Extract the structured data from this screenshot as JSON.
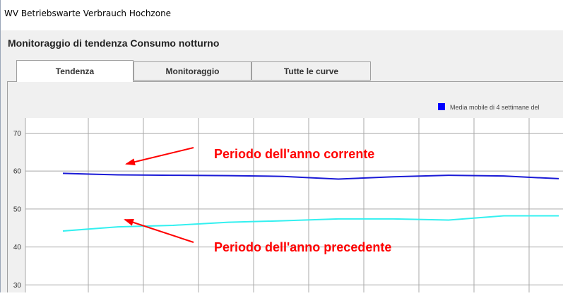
{
  "window": {
    "title": "WV Betriebswarte Verbrauch Hochzone"
  },
  "header": {
    "title": "Monitoraggio di tendenza Consumo notturno"
  },
  "tabs": [
    {
      "label": "Tendenza",
      "active": true
    },
    {
      "label": "Monitoraggio",
      "active": false
    },
    {
      "label": "Tutte le curve",
      "active": false
    }
  ],
  "annotations": {
    "current": "Periodo dell'anno corrente",
    "previous": "Periodo dell'anno precedente",
    "color": "#ff0000"
  },
  "chart_data": {
    "type": "line",
    "ylim": [
      28,
      74
    ],
    "yticks": [
      30,
      40,
      50,
      60,
      70
    ],
    "grid": true,
    "legend_position": "top-right",
    "legend": [
      {
        "label": "Media mobile di 4 settimane del",
        "color": "#0000ff"
      }
    ],
    "series": [
      {
        "color": "#1a1ad6",
        "values": [
          59.4,
          59.0,
          58.9,
          58.8,
          58.6,
          57.9,
          58.5,
          58.9,
          58.7,
          58.0
        ]
      },
      {
        "color": "#33f0f0",
        "values": [
          44.2,
          45.3,
          45.7,
          46.5,
          46.9,
          47.4,
          47.4,
          47.1,
          48.2,
          48.2
        ]
      }
    ]
  },
  "colors": {
    "panel_bg": "#f0f0f0",
    "plot_bg": "#ffffff",
    "grid": "#a9a9a9"
  }
}
